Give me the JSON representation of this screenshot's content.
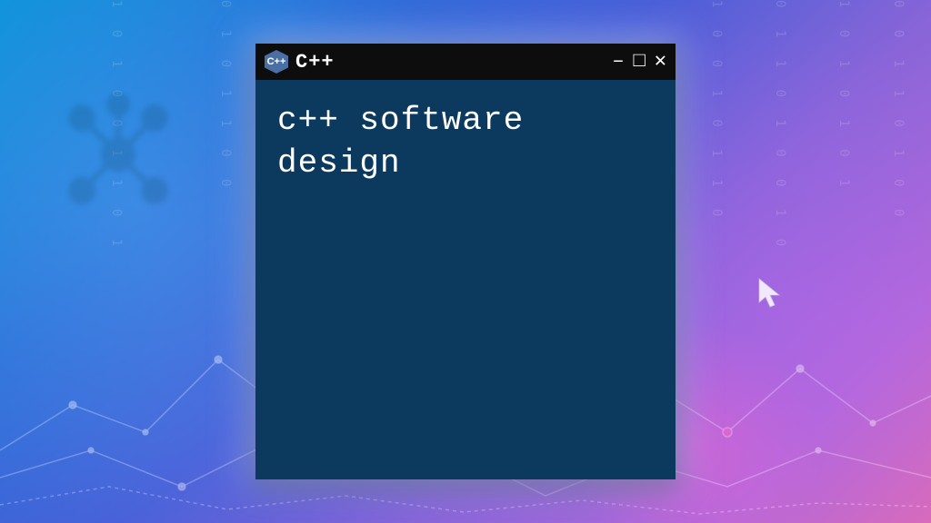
{
  "window": {
    "title": "C++",
    "icon_label": "C++",
    "controls": {
      "minimize": "–",
      "maximize": "□",
      "close": "✕"
    }
  },
  "content": {
    "text": "c++ software design"
  }
}
